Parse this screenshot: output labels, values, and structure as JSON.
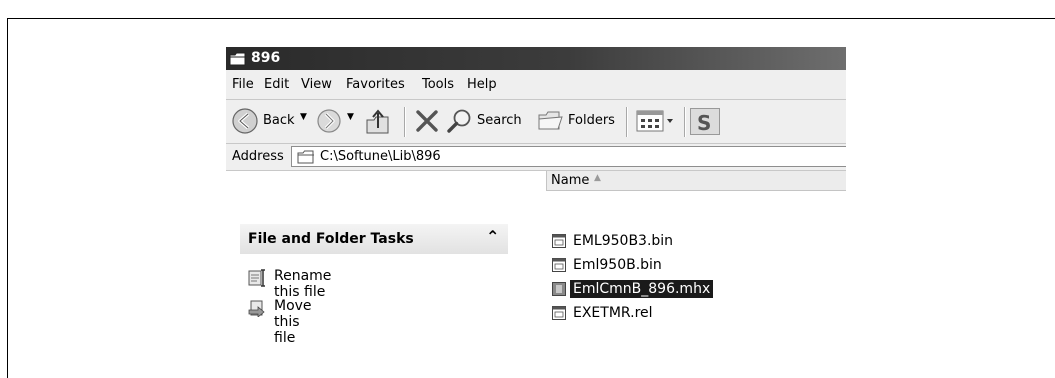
{
  "window": {
    "title": "896"
  },
  "menu": {
    "items": [
      "File",
      "Edit",
      "View",
      "Favorites",
      "Tools",
      "Help"
    ]
  },
  "toolbar": {
    "back_label": "Back",
    "search_label": "Search",
    "folders_label": "Folders",
    "icons": [
      "back-arrow-icon",
      "forward-arrow-icon",
      "up-folder-icon",
      "delete-x-icon",
      "search-magnifier-icon",
      "folders-icon",
      "views-icon"
    ]
  },
  "address": {
    "label": "Address",
    "value": "C:\\Softune\\Lib\\896"
  },
  "tasks": {
    "header": "File and Folder Tasks",
    "items": [
      {
        "label": "Rename this file",
        "icon": "rename-icon"
      },
      {
        "label": "Move this file",
        "icon": "move-icon"
      }
    ]
  },
  "filelist": {
    "column_name": "Name",
    "files": [
      {
        "name": "EML950B3.bin",
        "selected": false
      },
      {
        "name": "Eml950B.bin",
        "selected": false
      },
      {
        "name": "EmlCmnB_896.mhx",
        "selected": true
      },
      {
        "name": "EXETMR.rel",
        "selected": false
      }
    ]
  },
  "colors": {
    "titlebar": "#2a2a2a",
    "chrome": "#efefef",
    "selection": "#1a1a1a"
  }
}
